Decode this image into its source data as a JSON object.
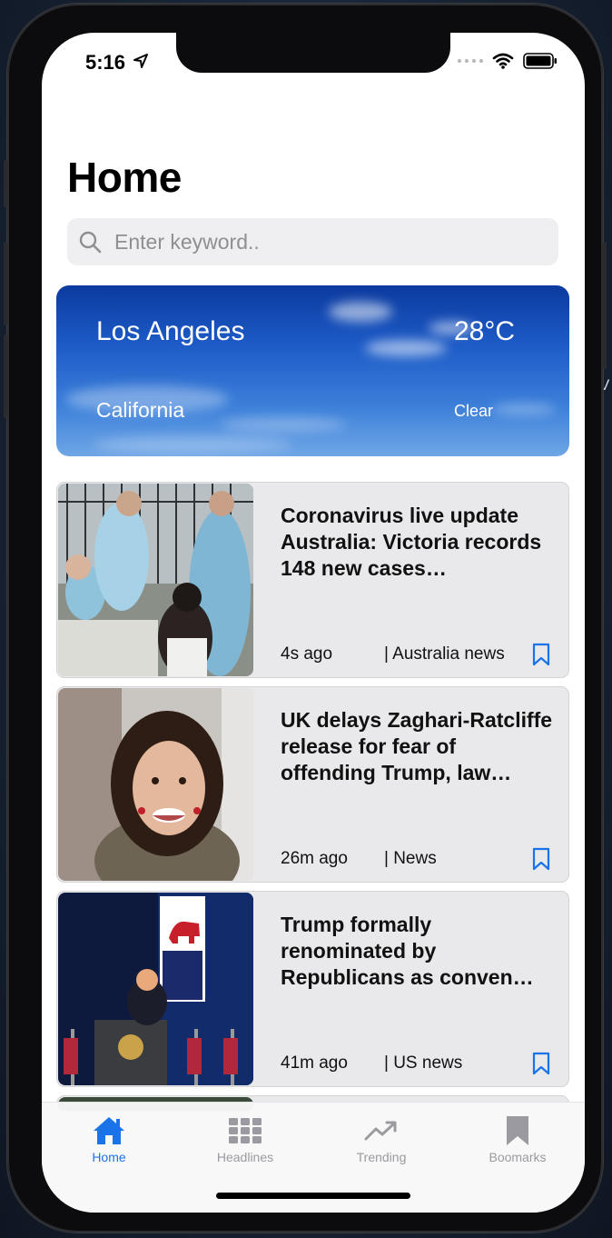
{
  "status_bar": {
    "time": "5:16"
  },
  "page": {
    "title": "Home"
  },
  "search": {
    "placeholder": "Enter keyword.."
  },
  "weather": {
    "city": "Los Angeles",
    "state": "California",
    "temperature": "28°C",
    "condition": "Clear"
  },
  "articles": [
    {
      "title": "Coronavirus live update Australia: Victoria records 148 new cases…",
      "time": "4s ago",
      "source": "| Australia news"
    },
    {
      "title": "UK delays Zaghari-Ratcliffe release for fear of offending Trump, law…",
      "time": "26m ago",
      "source": "| News"
    },
    {
      "title": "Trump formally renominated by Republicans as conven…",
      "time": "41m ago",
      "source": "| US news"
    }
  ],
  "tabbar": {
    "items": [
      {
        "label": "Home",
        "icon": "house-icon",
        "active": true
      },
      {
        "label": "Headlines",
        "icon": "grid-icon",
        "active": false
      },
      {
        "label": "Trending",
        "icon": "trending-icon",
        "active": false
      },
      {
        "label": "Boomarks",
        "icon": "bookmark-icon",
        "active": false
      }
    ]
  },
  "colors": {
    "accent": "#1a73e8",
    "card_background": "#e9e9ec",
    "tab_inactive": "#9a9aa0"
  },
  "side_text": "V"
}
